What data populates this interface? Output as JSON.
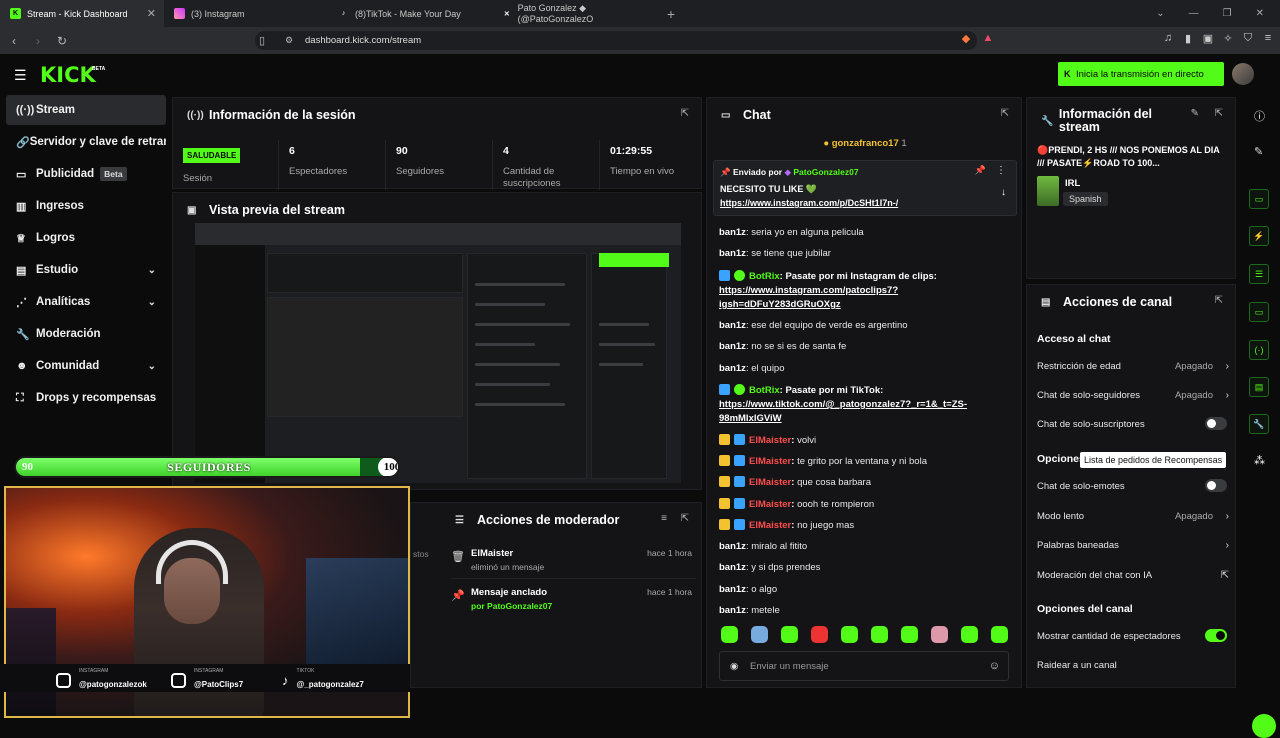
{
  "browser": {
    "tabs": [
      {
        "title": "Stream - Kick Dashboard",
        "active": true,
        "fav": "K"
      },
      {
        "title": "(3) Instagram",
        "fav": "ig"
      },
      {
        "title": "(8)TikTok - Make Your Day",
        "fav": "tt"
      },
      {
        "title": "Pato Gonzalez ◆ (@PatoGonzalezO",
        "fav": "X"
      }
    ],
    "url": "dashboard.kick.com/stream"
  },
  "topbar": {
    "logo": "KICK",
    "logo_sup": "BETA",
    "go_live": "Inicia la transmisión en directo"
  },
  "sidebar": {
    "items": [
      {
        "label": "Stream",
        "icon": "broadcast-icon"
      },
      {
        "label": "Servidor y clave de retransmisión",
        "icon": "link-icon"
      },
      {
        "label": "Publicidad",
        "badge": "Beta",
        "icon": "ad-icon"
      },
      {
        "label": "Ingresos",
        "icon": "chart-icon"
      },
      {
        "label": "Logros",
        "icon": "trophy-icon"
      },
      {
        "label": "Estudio",
        "icon": "studio-icon"
      },
      {
        "label": "Analíticas",
        "icon": "analytics-icon"
      },
      {
        "label": "Moderación",
        "icon": "wrench-icon"
      },
      {
        "label": "Comunidad",
        "icon": "community-icon"
      },
      {
        "label": "Drops y recompensas",
        "icon": "drops-icon"
      }
    ]
  },
  "session": {
    "title": "Información de la sesión",
    "status_badge": "SALUDABLE",
    "status_label": "Sesión",
    "stats": [
      {
        "value": "6",
        "label": "Espectadores"
      },
      {
        "value": "90",
        "label": "Seguidores"
      },
      {
        "value": "4",
        "label": "Cantidad de suscripciones"
      },
      {
        "value": "01:29:55",
        "label": "Tiempo en vivo"
      }
    ]
  },
  "preview": {
    "title": "Vista previa del stream"
  },
  "overlay": {
    "goal_label": "SEGUIDORES",
    "goal_current": "90",
    "goal_target": "100",
    "goal_progress": 0.9,
    "socials": [
      {
        "network": "INSTAGRAM",
        "handle": "@patogonzalezok"
      },
      {
        "network": "INSTAGRAM",
        "handle": "@PatoClips7"
      },
      {
        "network": "TIKTOK",
        "handle": "@_patogonzalez7"
      }
    ]
  },
  "mod_actions": {
    "title": "Acciones de moderador",
    "partial_left": "stos",
    "items": [
      {
        "user": "ElMaister",
        "desc": "eliminó un mensaje",
        "time": "hace 1 hora"
      },
      {
        "user": "Mensaje anclado",
        "desc": "por PatoGonzalez07",
        "time": "hace 1 hora"
      }
    ]
  },
  "chat": {
    "title": "Chat",
    "top_user": "gonzafranco17",
    "top_count": "1",
    "pinned": {
      "sent_by_label": "Enviado por",
      "sent_by": "PatoGonzalez07",
      "text": "NECESITO TU LIKE 💚",
      "link": "https://www.instagram.com/p/DcSHt1I7n-/"
    },
    "messages": [
      {
        "user": "ban1z",
        "text": "seria yo en alguna pelicula"
      },
      {
        "user": "ban1z",
        "text": "se tiene que jubilar"
      },
      {
        "user": "BotRix",
        "text": "Pasate por mi Instagram de clips:",
        "link1": "https://www.instagram.com/patoclips7?",
        "link2": "igsh=dDFuY283dGRuOXgz"
      },
      {
        "user": "ban1z",
        "text": "ese del equipo de verde es argentino"
      },
      {
        "user": "ban1z",
        "text": "no se si es de santa fe"
      },
      {
        "user": "ban1z",
        "text": "el quipo"
      },
      {
        "user": "BotRix",
        "text": "Pasate por mi TikTok:",
        "link1": "https://www.tiktok.com/@_patogonzalez7?_r=1&_t=ZS-",
        "link2": "98mMlxlGViW"
      },
      {
        "user": "ElMaister",
        "text": "volvi"
      },
      {
        "user": "ElMaister",
        "text": "te grito por la ventana y ni bola"
      },
      {
        "user": "ElMaister",
        "text": "que cosa barbara"
      },
      {
        "user": "ElMaister",
        "text": "oooh te rompieron"
      },
      {
        "user": "ElMaister",
        "text": "no juego mas"
      },
      {
        "user": "ban1z",
        "text": "miralo al fitito"
      },
      {
        "user": "ban1z",
        "text": "y si dps prendes"
      },
      {
        "user": "ban1z",
        "text": "o algo"
      },
      {
        "user": "ban1z",
        "text": "metele"
      }
    ],
    "input_placeholder": "Enviar un mensaje"
  },
  "stream_info": {
    "title": "Información del stream",
    "stream_title": "🔴PRENDI, 2 HS /// NOS PONEMOS AL DIA /// PASATE⚡ROAD TO 100...",
    "category": "IRL",
    "language": "Spanish"
  },
  "channel_actions": {
    "title": "Acciones de canal",
    "chat_access_header": "Acceso al chat",
    "rows_access": [
      {
        "label": "Restricción de edad",
        "value": "Apagado",
        "type": "select"
      },
      {
        "label": "Chat de solo-seguidores",
        "value": "Apagado",
        "type": "select"
      },
      {
        "label": "Chat de solo-suscriptores",
        "type": "toggle",
        "on": false
      }
    ],
    "options_header": "Opciones",
    "tooltip": "Lista de pedidos de Recompensas",
    "rows_options": [
      {
        "label": "Chat de solo-emotes",
        "type": "toggle",
        "on": false
      },
      {
        "label": "Modo lento",
        "value": "Apagado",
        "type": "select"
      },
      {
        "label": "Palabras baneadas",
        "type": "link"
      },
      {
        "label": "Moderación del chat con IA",
        "type": "external"
      }
    ],
    "channel_options_header": "Opciones del canal",
    "rows_channel": [
      {
        "label": "Mostrar cantidad de espectadores",
        "type": "toggle",
        "on": true
      },
      {
        "label": "Raidear a un canal",
        "type": "link"
      }
    ]
  }
}
